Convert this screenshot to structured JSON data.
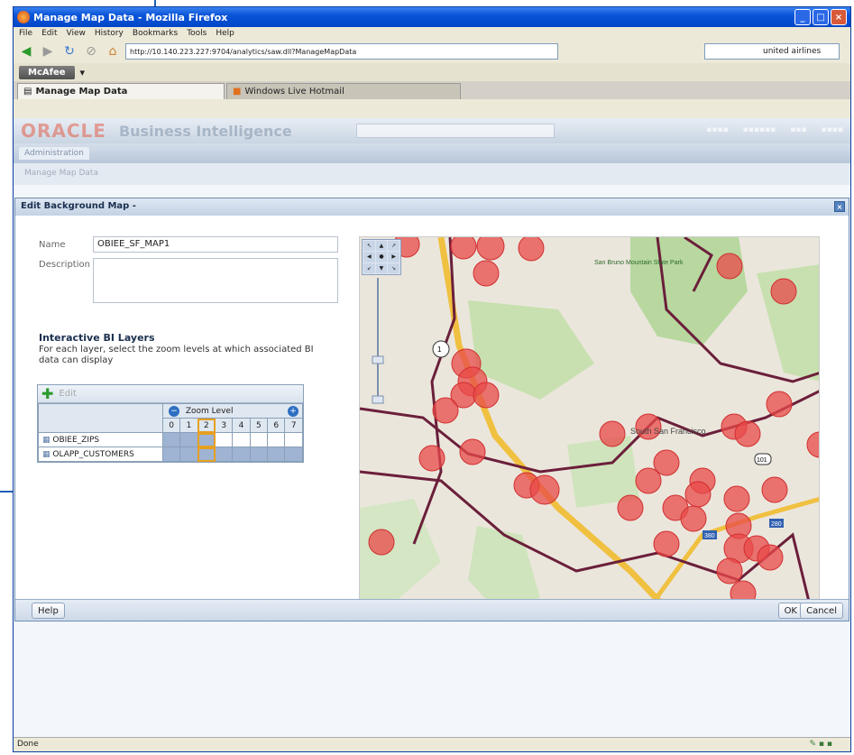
{
  "window": {
    "title": "Manage Map Data - Mozilla Firefox"
  },
  "menu": [
    "File",
    "Edit",
    "View",
    "History",
    "Bookmarks",
    "Tools",
    "Help"
  ],
  "nav": {
    "url": "http://10.140.223.227:9704/analytics/saw.dll?ManageMapData",
    "search_value": "united airlines"
  },
  "mcafee": {
    "label": "McAfee"
  },
  "tabs": [
    {
      "label": "Manage Map Data"
    },
    {
      "label": "Windows Live Hotmail"
    }
  ],
  "obi": {
    "brand": "ORACLE",
    "product": "Business Intelligence",
    "subtab": "Administration",
    "crumb": "Manage Map Data"
  },
  "dialog": {
    "title": "Edit Background Map -",
    "name_label": "Name",
    "name_value": "OBIEE_SF_MAP1",
    "description_label": "Description",
    "description_value": "",
    "layers_title": "Interactive BI Layers",
    "layers_desc": "For each layer, select the zoom levels at which associated BI data can display",
    "toolbar_label": "Edit",
    "zoom_label": "Zoom Level",
    "zoom_levels": [
      "0",
      "1",
      "2",
      "3",
      "4",
      "5",
      "6",
      "7"
    ],
    "layers": [
      {
        "name": "OBIEE_ZIPS",
        "on": [
          0,
          1,
          2
        ]
      },
      {
        "name": "OLAPP_CUSTOMERS",
        "on": [
          0,
          1,
          2,
          3,
          4,
          5,
          6,
          7
        ]
      }
    ],
    "help_button": "Help",
    "ok_button": "OK",
    "cancel_button": "Cancel"
  },
  "map": {
    "labels": [
      "San Bruno Mountain State Park",
      "South San Francisco",
      "101",
      "380",
      "280",
      "1"
    ]
  },
  "status": {
    "text": "Done"
  },
  "colors": {
    "accent": "#0a54d8",
    "point": "#e84a4a",
    "road": "#f0c040",
    "boundary": "#6b1f3a"
  }
}
